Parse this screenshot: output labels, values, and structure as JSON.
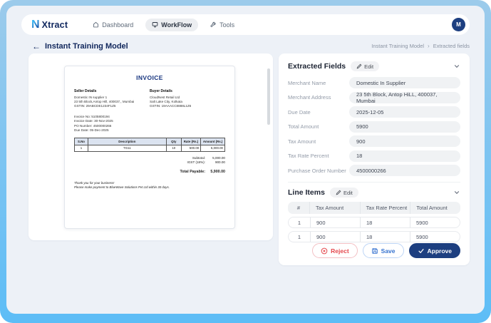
{
  "header": {
    "brand": {
      "n": "N",
      "name": "Xtract"
    },
    "nav": [
      {
        "label": "Dashboard"
      },
      {
        "label": "WorkFlow"
      },
      {
        "label": "Tools"
      }
    ],
    "avatar": "M"
  },
  "page": {
    "back_arrow": "←",
    "title": "Instant Training Model",
    "breadcrumb": {
      "parent": "Instant Training Model",
      "separator": "›",
      "current": "Extracted fields"
    }
  },
  "invoice": {
    "title": "INVOICE",
    "seller": {
      "heading": "Seller Details",
      "lines": [
        "Domestic IN supplier 1",
        "23 5th Block,Antop Hill, 400037,, Mumbai",
        "GSTIN: 29ABCDE1234F1Z5"
      ]
    },
    "buyer": {
      "heading": "Buyer Details",
      "lines": [
        "CloudNest Retail Ltd",
        "Salt Lake City, Kolkata",
        "GSTIN: 19AAACC8888L1Z6"
      ]
    },
    "meta": [
      "Invoice No: 5105800194",
      "Invoice Date: 30-Nov-2025",
      "PO Number: 4500000266",
      "Due Date: 05-Dec-2025"
    ],
    "table": {
      "headers": [
        "S.No",
        "Description",
        "Qty",
        "Rate (Rs.)",
        "Amount (Rs.)"
      ],
      "rows": [
        [
          "1",
          "TG11",
          "10",
          "500.00",
          "5,000.00"
        ]
      ]
    },
    "totals": [
      {
        "label": "Subtotal:",
        "value": "5,000.00"
      },
      {
        "label": "IGST (18%):",
        "value": "900.00"
      }
    ],
    "total_payable": {
      "label": "Total Payable:",
      "value": "5,900.00"
    },
    "footer": [
      "Thank you for your business!",
      "Please make payment to BlueWave Solutions Pvt Ltd within 30 days."
    ]
  },
  "extracted": {
    "title": "Extracted Fields",
    "edit_label": "Edit",
    "fields": [
      {
        "label": "Merchant Name",
        "value": "Domestic In Supplier"
      },
      {
        "label": "Merchant Address",
        "value": "23 5th Block, Antop HiLL, 400037, Mumbai"
      },
      {
        "label": "Due Date",
        "value": "2025-12-05"
      },
      {
        "label": "Total Amount",
        "value": "5900"
      },
      {
        "label": "Tax Amount",
        "value": "900"
      },
      {
        "label": "Tax Rate Percent",
        "value": "18"
      },
      {
        "label": "Purchase Order Number",
        "value": "4500000266"
      }
    ]
  },
  "line_items": {
    "title": "Line Items",
    "edit_label": "Edit",
    "headers": [
      "#",
      "Tax Amount",
      "Tax Rate Percent",
      "Total Amount"
    ],
    "rows": [
      [
        "1",
        "900",
        "18",
        "5900"
      ],
      [
        "1",
        "900",
        "18",
        "5900"
      ]
    ]
  },
  "actions": {
    "reject": "Reject",
    "save": "Save",
    "approve": "Approve"
  },
  "colors": {
    "accent_navy": "#1d3f80",
    "reject_red": "#e5484d",
    "save_blue": "#3572cf",
    "frame_blue": "#5dbdf6"
  }
}
